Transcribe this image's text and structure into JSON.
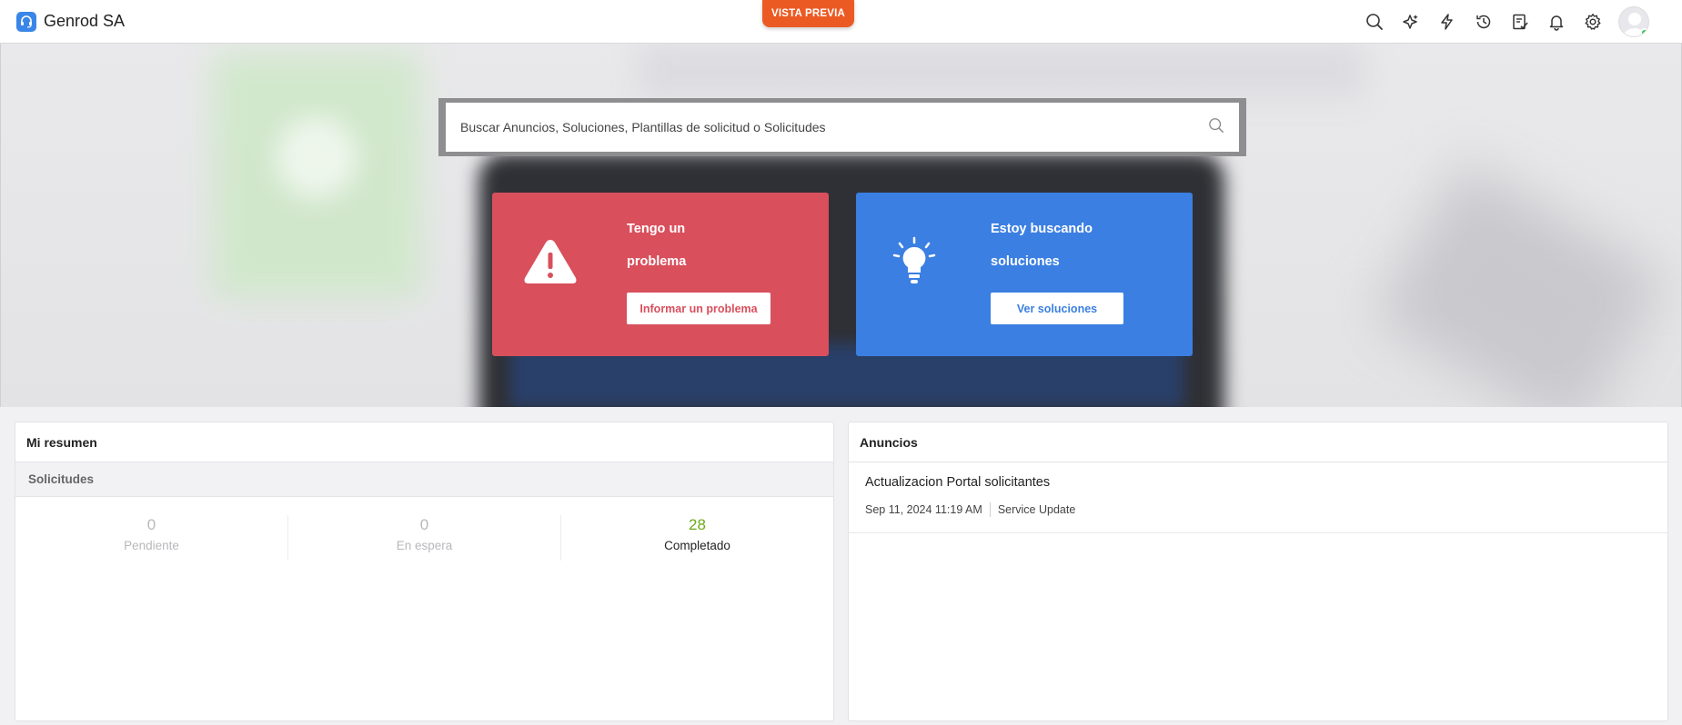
{
  "header": {
    "brand_name": "Genrod SA",
    "preview_label": "VISTA PREVIA",
    "icons": [
      "search-icon",
      "sparkle-icon",
      "lightning-icon",
      "history-icon",
      "checklist-icon",
      "bell-icon",
      "gear-icon",
      "avatar"
    ]
  },
  "search": {
    "placeholder": "Buscar Anuncios, Soluciones, Plantillas de solicitud o Solicitudes"
  },
  "cards": {
    "problem": {
      "line1": "Tengo un",
      "line2": "problema",
      "button": "Informar un problema",
      "color": "#d94f5c"
    },
    "solutions": {
      "line1": "Estoy buscando",
      "line2": "soluciones",
      "button": "Ver soluciones",
      "color": "#3b7fe2"
    }
  },
  "summary": {
    "title": "Mi resumen",
    "section": "Solicitudes",
    "stats": [
      {
        "value": "0",
        "label": "Pendiente"
      },
      {
        "value": "0",
        "label": "En espera"
      },
      {
        "value": "28",
        "label": "Completado"
      }
    ]
  },
  "announcements": {
    "title": "Anuncios",
    "items": [
      {
        "title": "Actualizacion Portal solicitantes",
        "date": "Sep 11, 2024 11:19 AM",
        "category": "Service Update"
      }
    ]
  },
  "colors": {
    "accent_orange": "#ec5a24",
    "completed_green": "#6aaa1a",
    "online_green": "#2bc24a"
  }
}
